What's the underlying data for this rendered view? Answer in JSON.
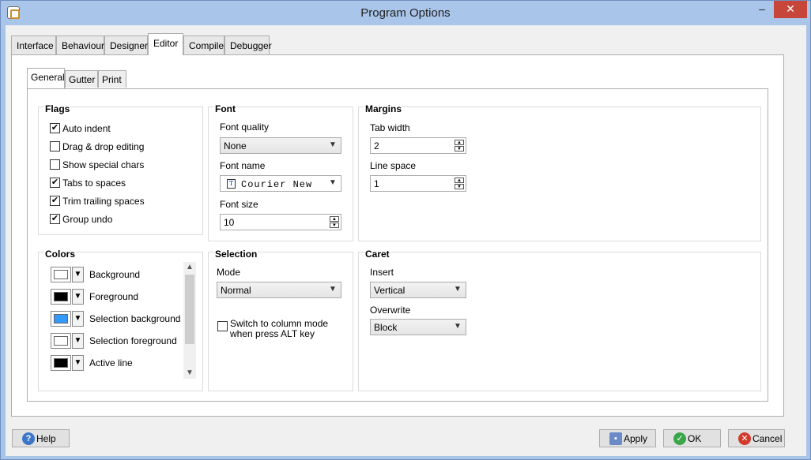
{
  "window": {
    "title": "Program Options",
    "minimize": "–",
    "close": "✕"
  },
  "tabs": [
    {
      "label": "Interface"
    },
    {
      "label": "Behaviour"
    },
    {
      "label": "Designer"
    },
    {
      "label": "Editor"
    },
    {
      "label": "Compiler"
    },
    {
      "label": "Debugger"
    }
  ],
  "subtabs": [
    {
      "label": "General"
    },
    {
      "label": "Gutter"
    },
    {
      "label": "Print"
    }
  ],
  "flags": {
    "title": "Flags",
    "items": [
      {
        "label": "Auto indent",
        "checked": true
      },
      {
        "label": "Drag & drop editing",
        "checked": false
      },
      {
        "label": "Show special chars",
        "checked": false
      },
      {
        "label": "Tabs to spaces",
        "checked": true
      },
      {
        "label": "Trim trailing spaces",
        "checked": true
      },
      {
        "label": "Group undo",
        "checked": true
      }
    ]
  },
  "font": {
    "title": "Font",
    "quality_label": "Font quality",
    "quality_value": "None",
    "name_label": "Font name",
    "name_value": "Courier New",
    "size_label": "Font size",
    "size_value": "10"
  },
  "margins": {
    "title": "Margins",
    "tab_width_label": "Tab width",
    "tab_width_value": "2",
    "line_space_label": "Line space",
    "line_space_value": "1"
  },
  "colors": {
    "title": "Colors",
    "items": [
      {
        "label": "Background",
        "color": "#ffffff"
      },
      {
        "label": "Foreground",
        "color": "#000000"
      },
      {
        "label": "Selection background",
        "color": "#3399ff"
      },
      {
        "label": "Selection foreground",
        "color": "#ffffff"
      },
      {
        "label": "Active line",
        "color": "#000000"
      }
    ]
  },
  "selection": {
    "title": "Selection",
    "mode_label": "Mode",
    "mode_value": "Normal",
    "column_mode_label": "Switch to column mode when press ALT key",
    "column_mode_checked": false
  },
  "caret": {
    "title": "Caret",
    "insert_label": "Insert",
    "insert_value": "Vertical",
    "overwrite_label": "Overwrite",
    "overwrite_value": "Block"
  },
  "buttons": {
    "help": "Help",
    "apply": "Apply",
    "ok": "OK",
    "cancel": "Cancel"
  },
  "icons": {
    "check": "✔",
    "dropdown": "▼",
    "spin_up": "▲",
    "spin_down": "▼"
  }
}
